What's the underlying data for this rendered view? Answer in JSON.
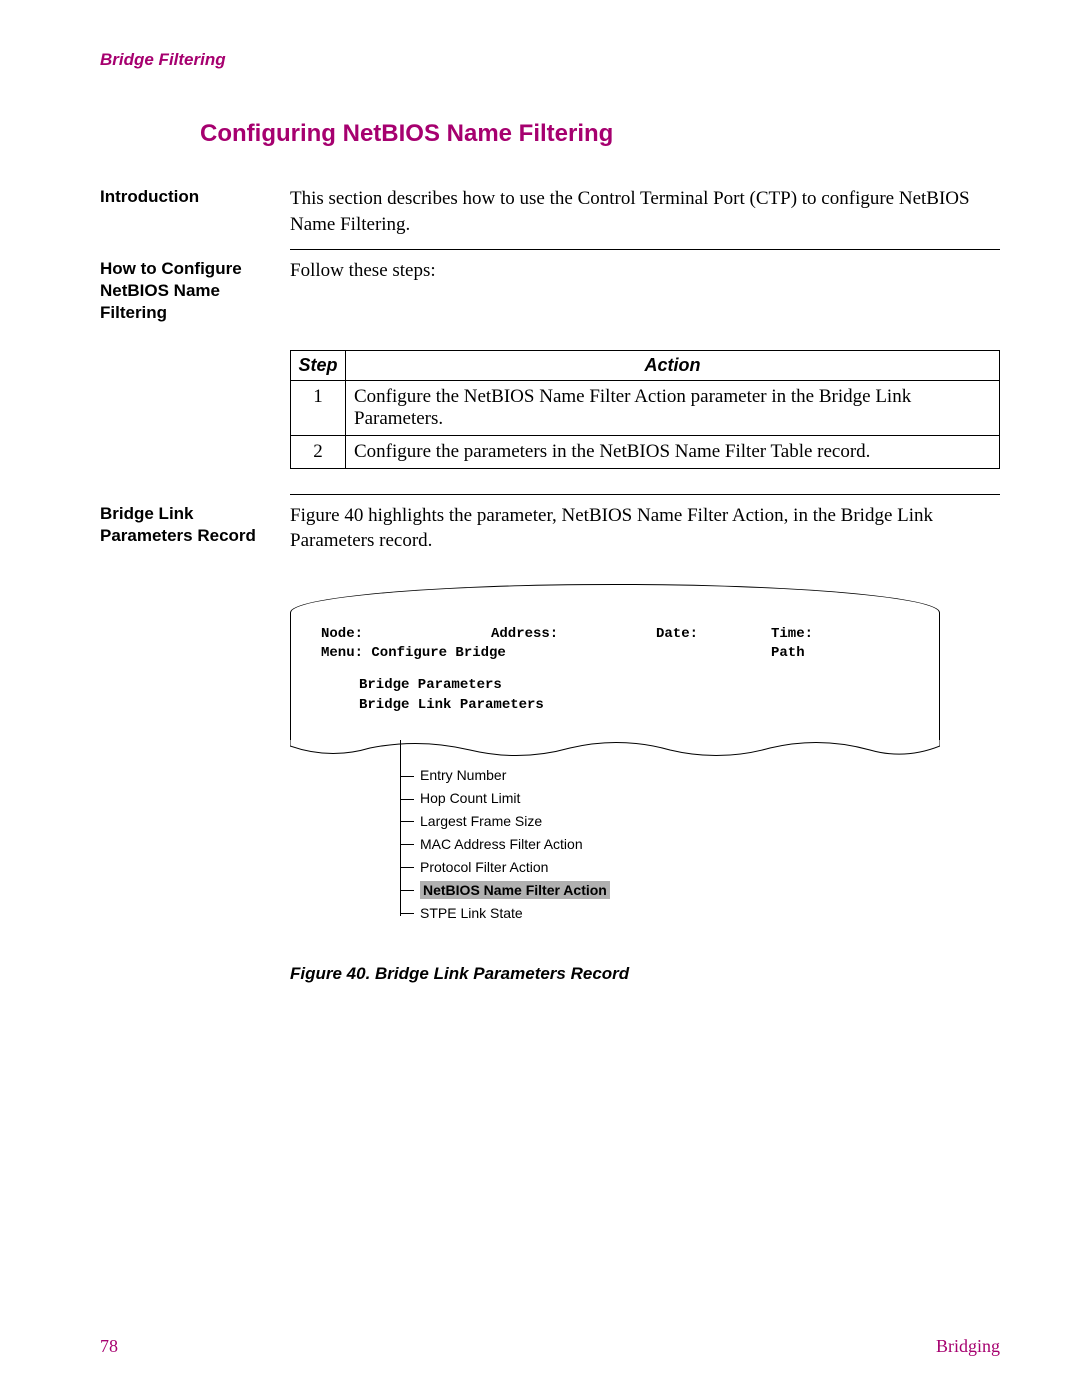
{
  "header": {
    "label": "Bridge Filtering"
  },
  "title": "Configuring NetBIOS Name Filtering",
  "sections": {
    "intro": {
      "label": "Introduction",
      "text": "This section describes how to use the Control Terminal Port (CTP) to configure NetBIOS Name Filtering."
    },
    "howto": {
      "label": "How to Configure NetBIOS Name Filtering",
      "text": "Follow these steps:"
    },
    "bridgelink": {
      "label": "Bridge Link Parameters Record",
      "text": "Figure 40 highlights the parameter, NetBIOS Name Filter Action, in the Bridge Link Parameters record."
    }
  },
  "steps_table": {
    "headers": {
      "step": "Step",
      "action": "Action"
    },
    "rows": [
      {
        "step": "1",
        "action": "Configure the NetBIOS Name Filter Action parameter in the Bridge Link Parameters."
      },
      {
        "step": "2",
        "action": "Configure the parameters in the NetBIOS Name Filter Table record."
      }
    ]
  },
  "terminal": {
    "node": "Node:",
    "address": "Address:",
    "date": "Date:",
    "time": "Time:",
    "menu": "Menu: Configure Bridge",
    "path": "Path",
    "line1": "Bridge Parameters",
    "line2": "Bridge Link Parameters"
  },
  "tree_items": [
    {
      "label": "Entry Number",
      "highlight": false
    },
    {
      "label": "Hop Count Limit",
      "highlight": false
    },
    {
      "label": "Largest Frame Size",
      "highlight": false
    },
    {
      "label": "MAC Address Filter Action",
      "highlight": false
    },
    {
      "label": "Protocol Filter Action",
      "highlight": false
    },
    {
      "label": "NetBIOS Name Filter Action",
      "highlight": true
    },
    {
      "label": "STPE Link State",
      "highlight": false
    }
  ],
  "figure_caption": "Figure 40. Bridge Link Parameters Record",
  "footer": {
    "page": "78",
    "chapter": "Bridging"
  }
}
